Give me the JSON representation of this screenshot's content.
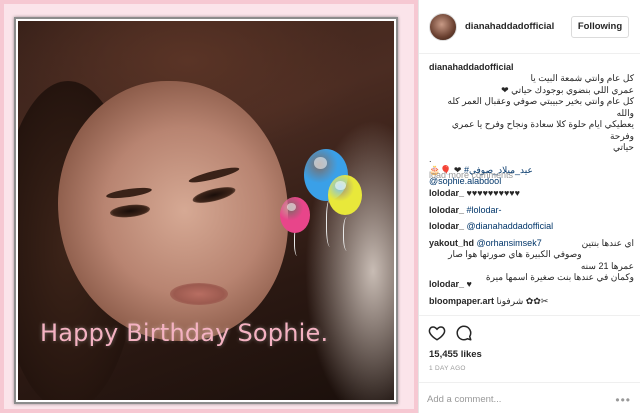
{
  "photo": {
    "caption": "Happy Birthday Sophie.",
    "balloon_colors": [
      "#3aa0e8",
      "#e8e83a",
      "#e8458a"
    ]
  },
  "header": {
    "username": "dianahaddadofficial",
    "follow_label": "Following"
  },
  "post": {
    "username": "dianahaddadofficial",
    "caption_lines": [
      "كل عام وانتي شمعة البيت يا",
      "عمري اللي بنضوي بوجودك حياتي ❤",
      "كل عام وانتي بخير حبيبتي صوفي وعقبال العمر كله والله",
      "يعطيكي ايام حلوة كلا سعادة ونجاح وفرح يا عمري وفرحة",
      "حياتي",
      "."
    ],
    "hashtag": "#عيد_ميلاد_صوفي",
    "hashtag_emoji": "🎂🎈 ❤",
    "mention": "@sophie.alabdool"
  },
  "load_more": "load more comments",
  "comments": [
    {
      "user": "lolodar_",
      "text": "♥♥♥♥♥♥♥♥♥♥"
    },
    {
      "user": "lolodar_",
      "text": "#lolodar-"
    },
    {
      "user": "lolodar_",
      "text": "@dianahaddadofficial"
    },
    {
      "user": "yakout_hd",
      "mention": "@orhansimsek7",
      "arabic_lines": [
        "اي عندها بنتين",
        "وصوفي الكبيرة هاي صورتها هوا صار عمرها 21 سنه",
        "وكمان في عندها بنت صغيرة اسمها ميرة"
      ]
    },
    {
      "user": "lolodar_",
      "text": "♥"
    },
    {
      "user": "bloompaper.art",
      "text": "شرفونا ✿✿✂"
    }
  ],
  "likes": "15,455 likes",
  "time_ago": "1 DAY AGO",
  "add_comment_placeholder": "Add a comment...",
  "more_options": "•••",
  "icons": {
    "like": "heart-icon",
    "comment": "comment-bubble-icon",
    "more": "more-options-icon"
  }
}
